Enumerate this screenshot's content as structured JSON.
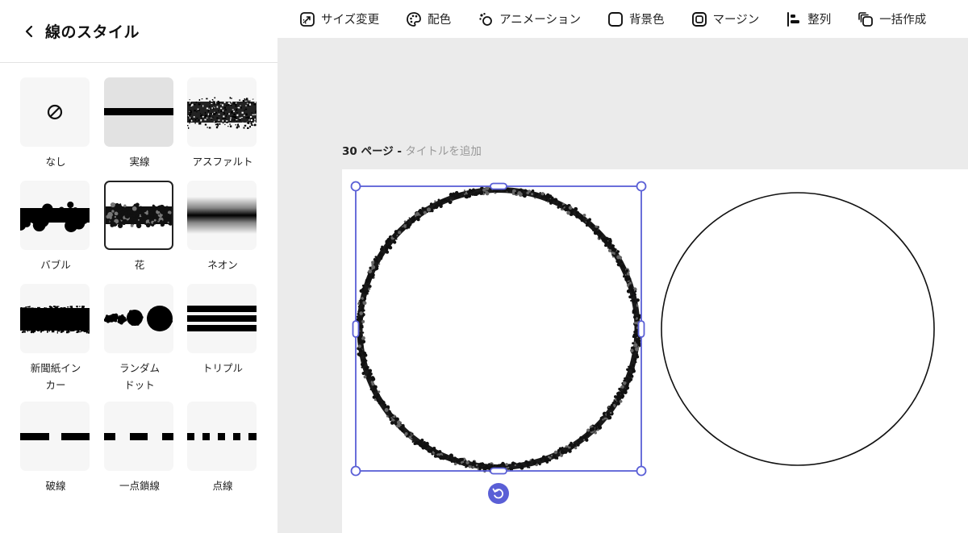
{
  "sidebar": {
    "title": "線のスタイル",
    "styles": [
      {
        "id": "none",
        "label": "なし"
      },
      {
        "id": "solid",
        "label": "実線"
      },
      {
        "id": "asphalt",
        "label": "アスファルト"
      },
      {
        "id": "bubble",
        "label": "バブル"
      },
      {
        "id": "flower",
        "label": "花"
      },
      {
        "id": "neon",
        "label": "ネオン"
      },
      {
        "id": "newsprint",
        "label_line1": "新聞紙イン",
        "label_line2": "カー"
      },
      {
        "id": "random-dot",
        "label_line1": "ランダム",
        "label_line2": "ドット"
      },
      {
        "id": "triple",
        "label": "トリプル"
      },
      {
        "id": "dashed",
        "label": "破線"
      },
      {
        "id": "dash-dot",
        "label": "一点鎖線"
      },
      {
        "id": "dotted",
        "label": "点線"
      }
    ],
    "selected": "flower"
  },
  "toolbar": {
    "items": [
      {
        "label": "サイズ変更",
        "icon": "resize-icon"
      },
      {
        "label": "配色",
        "icon": "palette-icon"
      },
      {
        "label": "アニメーション",
        "icon": "animation-icon"
      },
      {
        "label": "背景色",
        "icon": "background-color-icon"
      },
      {
        "label": "マージン",
        "icon": "margin-icon"
      },
      {
        "label": "整列",
        "icon": "align-icon"
      },
      {
        "label": "一括作成",
        "icon": "bulk-create-icon"
      }
    ]
  },
  "page": {
    "number_label": "30 ページ -",
    "title_placeholder": "タイトルを追加"
  },
  "colors": {
    "selection": "#5a5fd6",
    "canvas_bg": "#ebebeb",
    "stroke": "#111111"
  }
}
